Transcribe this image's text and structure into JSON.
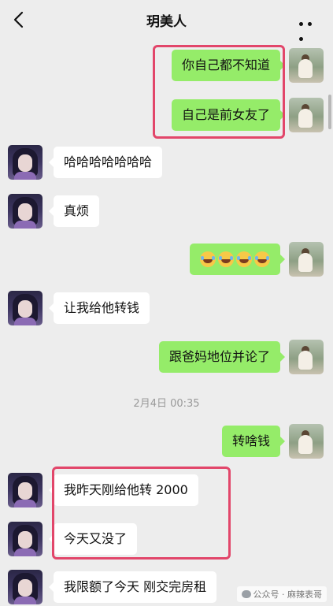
{
  "header": {
    "title": "玥美人",
    "back_icon": "chevron-left-icon",
    "more_icon": "more-dots-icon"
  },
  "messages": [
    {
      "side": "out",
      "text": "你自己都不知道"
    },
    {
      "side": "out",
      "text": "自己是前女友了"
    },
    {
      "side": "in",
      "text": "哈哈哈哈哈哈哈"
    },
    {
      "side": "in",
      "text": "真烦"
    },
    {
      "side": "out",
      "text": "😂😂😂😂",
      "emoji_count": 4
    },
    {
      "side": "in",
      "text": "让我给他转钱"
    },
    {
      "side": "out",
      "text": "跟爸妈地位并论了"
    },
    {
      "side": "out",
      "text": "转啥钱"
    },
    {
      "side": "in",
      "text": "我昨天刚给他转 2000"
    },
    {
      "side": "in",
      "text": "今天又没了"
    },
    {
      "side": "in",
      "text": "我限额了今天 刚交完房租"
    }
  ],
  "timestamp": "2月4日 00:35",
  "watermark": "公众号 · 麻辣表哥",
  "colors": {
    "background": "#ededed",
    "outgoing_bubble": "#95ec69",
    "incoming_bubble": "#ffffff",
    "highlight": "#e2466a"
  }
}
